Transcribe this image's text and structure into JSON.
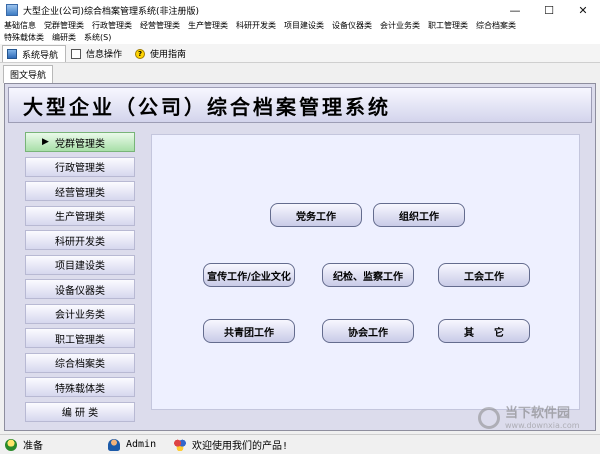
{
  "window": {
    "title": "大型企业(公司)综合档案管理系统(非注册版)",
    "controls": [
      "—",
      "☐",
      "✕"
    ]
  },
  "menu": {
    "row1": [
      "基础信息",
      "党群管理类",
      "行政管理类",
      "经营管理类",
      "生产管理类",
      "科研开发类",
      "项目建设类",
      "设备仪器类",
      "会计业务类",
      "职工管理类",
      "综合档案类"
    ],
    "row2": [
      "特殊载体类",
      "编研类",
      "系统(S)"
    ]
  },
  "toolbar": {
    "tabs": [
      {
        "label": "系统导航",
        "icon": "nav-icon"
      },
      {
        "label": "信息操作",
        "icon": "info-icon"
      },
      {
        "label": "使用指南",
        "icon": "help-icon"
      }
    ]
  },
  "subtab": {
    "label": "图文导航"
  },
  "banner": {
    "title": "大型企业（公司）综合档案管理系统"
  },
  "nav": {
    "items": [
      "党群管理类",
      "行政管理类",
      "经营管理类",
      "生产管理类",
      "科研开发类",
      "项目建设类",
      "设备仪器类",
      "会计业务类",
      "职工管理类",
      "综合档案类",
      "特殊载体类",
      "编 研 类"
    ],
    "active_index": 0
  },
  "content": {
    "buttons": [
      "党务工作",
      "组织工作",
      "宣传工作/企业文化",
      "纪检、监察工作",
      "工会工作",
      "共青团工作",
      "协会工作",
      "其　　它"
    ]
  },
  "status": {
    "ready": "准备",
    "user": "Admin",
    "welcome": "欢迎使用我们的产品!"
  },
  "watermark": {
    "main": "当下软件园",
    "sub": "www.downxia.com"
  },
  "colors": {
    "banner_bg": "#d3d4ec",
    "content_bg": "#eef0ff",
    "nav_active": "#a8dfa8"
  }
}
